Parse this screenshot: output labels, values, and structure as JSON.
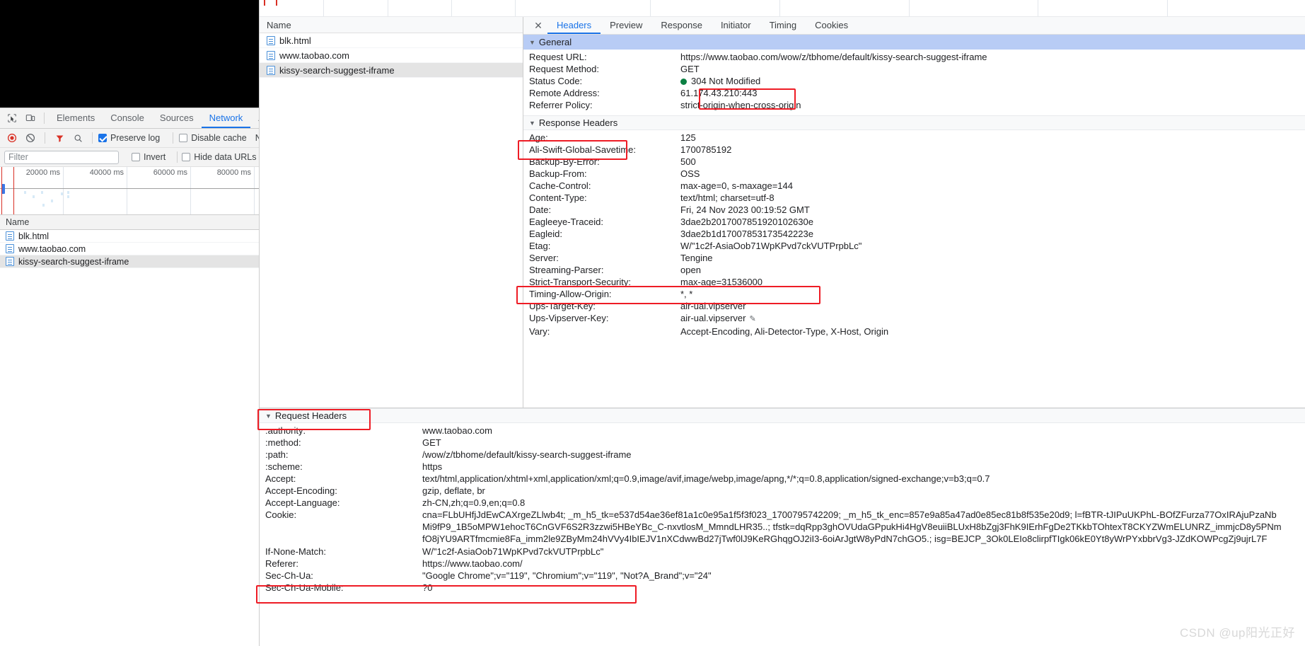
{
  "devtools": {
    "tabs": [
      {
        "label": "Elements",
        "active": false
      },
      {
        "label": "Console",
        "active": false
      },
      {
        "label": "Sources",
        "active": false
      },
      {
        "label": "Network",
        "active": true
      },
      {
        "label": "Ap",
        "active": false
      }
    ],
    "icons": {
      "inspect": "inspect-element-icon",
      "device": "device-toolbar-icon",
      "record": "record-icon",
      "clear": "clear-icon",
      "filter": "filter-icon",
      "search": "search-icon"
    },
    "toolbar": {
      "preserve_log_label": "Preserve log",
      "preserve_log_checked": true,
      "disable_cache_label": "Disable cache",
      "disable_cache_checked": false,
      "throttling_label": "No t"
    },
    "filterbar": {
      "filter_placeholder": "Filter",
      "filter_value": "",
      "invert_label": "Invert",
      "invert_checked": false,
      "hide_data_urls_label": "Hide data URLs",
      "hide_data_urls_checked": false
    },
    "overview": {
      "ticks": [
        "20000 ms",
        "40000 ms",
        "60000 ms",
        "80000 ms"
      ]
    },
    "requests_header": "Name",
    "requests": [
      {
        "name": "blk.html",
        "selected": false
      },
      {
        "name": "www.taobao.com",
        "selected": false
      },
      {
        "name": "kissy-search-suggest-iframe",
        "selected": true
      }
    ]
  },
  "detail": {
    "list_header": "Name",
    "requests": [
      {
        "name": "blk.html",
        "selected": false
      },
      {
        "name": "www.taobao.com",
        "selected": false
      },
      {
        "name": "kissy-search-suggest-iframe",
        "selected": true
      }
    ],
    "tabs": [
      {
        "label": "Headers",
        "active": true
      },
      {
        "label": "Preview",
        "active": false
      },
      {
        "label": "Response",
        "active": false
      },
      {
        "label": "Initiator",
        "active": false
      },
      {
        "label": "Timing",
        "active": false
      },
      {
        "label": "Cookies",
        "active": false
      }
    ],
    "close_label": "✕",
    "general": {
      "title": "General",
      "rows": [
        {
          "key": "Request URL:",
          "value": "https://www.taobao.com/wow/z/tbhome/default/kissy-search-suggest-iframe"
        },
        {
          "key": "Request Method:",
          "value": "GET"
        },
        {
          "key": "Status Code:",
          "value": "304 Not Modified",
          "status": true
        },
        {
          "key": "Remote Address:",
          "value": "61.174.43.210:443"
        },
        {
          "key": "Referrer Policy:",
          "value": "strict-origin-when-cross-origin"
        }
      ]
    },
    "response_headers": {
      "title": "Response Headers",
      "rows": [
        {
          "key": "Age:",
          "value": "125"
        },
        {
          "key": "Ali-Swift-Global-Savetime:",
          "value": "1700785192"
        },
        {
          "key": "Backup-By-Error:",
          "value": "500"
        },
        {
          "key": "Backup-From:",
          "value": "OSS"
        },
        {
          "key": "Cache-Control:",
          "value": "max-age=0, s-maxage=144"
        },
        {
          "key": "Content-Type:",
          "value": "text/html; charset=utf-8"
        },
        {
          "key": "Date:",
          "value": "Fri, 24 Nov 2023 00:19:52 GMT"
        },
        {
          "key": "Eagleeye-Traceid:",
          "value": "3dae2b2017007851920102630e"
        },
        {
          "key": "Eagleid:",
          "value": "3dae2b1d17007853173542223e"
        },
        {
          "key": "Etag:",
          "value": "W/\"1c2f-AsiaOob71WpKPvd7ckVUTPrpbLc\""
        },
        {
          "key": "Server:",
          "value": "Tengine"
        },
        {
          "key": "Streaming-Parser:",
          "value": "open"
        },
        {
          "key": "Strict-Transport-Security:",
          "value": "max-age=31536000"
        },
        {
          "key": "Timing-Allow-Origin:",
          "value": "*, *"
        },
        {
          "key": "Ups-Target-Key:",
          "value": "air-ual.vipserver"
        },
        {
          "key": "Ups-Vipserver-Key:",
          "value": "air-ual.vipserver",
          "pencil": true
        },
        {
          "key": "Vary:",
          "value": "Accept-Encoding, Ali-Detector-Type, X-Host, Origin"
        }
      ]
    },
    "request_headers": {
      "title": "Request Headers",
      "rows": [
        {
          "key": ":authority:",
          "value": "www.taobao.com"
        },
        {
          "key": ":method:",
          "value": "GET"
        },
        {
          "key": ":path:",
          "value": "/wow/z/tbhome/default/kissy-search-suggest-iframe"
        },
        {
          "key": ":scheme:",
          "value": "https"
        },
        {
          "key": "Accept:",
          "value": "text/html,application/xhtml+xml,application/xml;q=0.9,image/avif,image/webp,image/apng,*/*;q=0.8,application/signed-exchange;v=b3;q=0.7"
        },
        {
          "key": "Accept-Encoding:",
          "value": "gzip, deflate, br"
        },
        {
          "key": "Accept-Language:",
          "value": "zh-CN,zh;q=0.9,en;q=0.8"
        },
        {
          "key": "Cookie:",
          "value": "cna=FLbUHfjJdEwCAXrgeZLlwb4t; _m_h5_tk=e537d54ae36ef81a1c0e95a1f5f3f023_1700795742209; _m_h5_tk_enc=857e9a85a47ad0e85ec81b8f535e20d9; l=fBTR-tJIPuUKPhL-BOfZFurza77OxIRAjuPzaNbMi9fP9_1B5oMPW1ehocT6CnGVF6S2R3zzwi5HBeYBc_C-nxvtlosM_MmndLHR35..; tfstk=dqRpp3ghOVUdaGPpukHi4HgV8euiiBLUxH8bZgj3FhK9IErhFgDe2TKkbTOhtexT8CKYZWmELUNRZ_immjcD8y5PNmfO8jYU9ARTfmcmie8Fa_imm2le9ZByMm24hVVy4IbIEJV1nXCdwwBd27jTwf0lJ9KeRGhqgOJ2iI3-6oiArJgtW8yPdN7chGO5.; isg=BEJCP_3Ok0LEIo8clirpfTIgk06kE0Yt8yWrPYxbbrVg3-JZdKOWPcgZj9ujrL7F"
        },
        {
          "key": "If-None-Match:",
          "value": "W/\"1c2f-AsiaOob71WpKPvd7ckVUTPrpbLc\""
        },
        {
          "key": "Referer:",
          "value": "https://www.taobao.com/"
        },
        {
          "key": "Sec-Ch-Ua:",
          "value": "\"Google Chrome\";v=\"119\", \"Chromium\";v=\"119\", \"Not?A_Brand\";v=\"24\""
        },
        {
          "key": "Sec-Ch-Ua-Mobile:",
          "value": "?0"
        }
      ]
    }
  },
  "annotations": {
    "color": "#ee1c25",
    "boxes": [
      "status-code-highlight",
      "response-headers-title-highlight",
      "etag-row-highlight",
      "request-headers-title-highlight",
      "if-none-match-row-highlight"
    ]
  },
  "watermark": {
    "text": "CSDN @up阳光正好"
  }
}
